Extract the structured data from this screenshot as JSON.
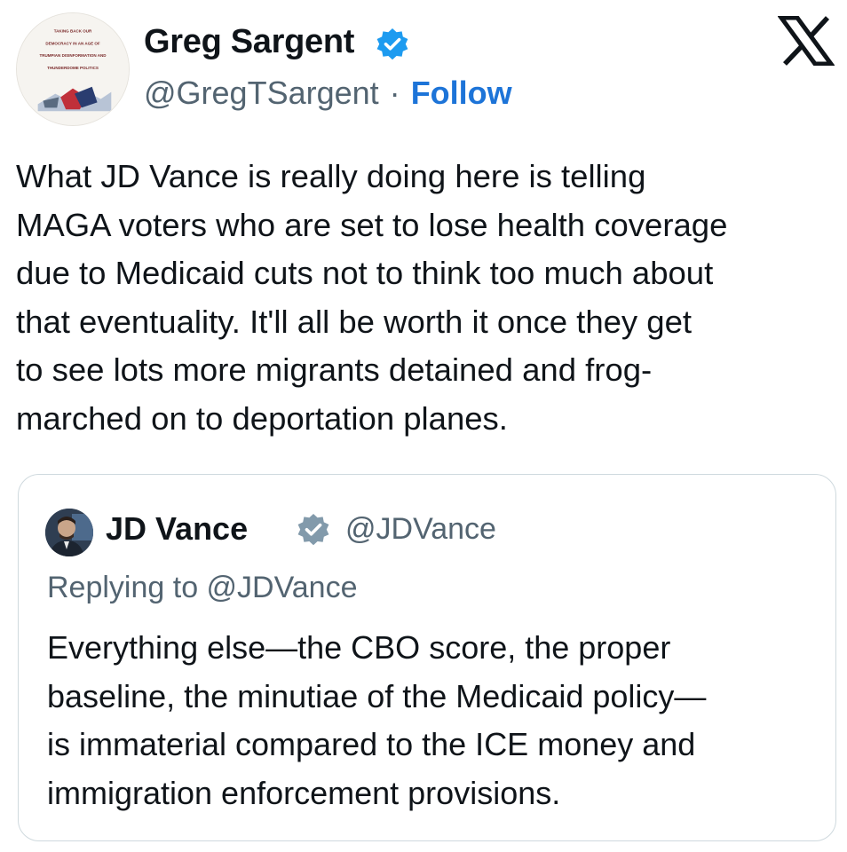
{
  "post": {
    "author": {
      "name": "Greg Sargent",
      "handle": "@GregTSargent",
      "separator": "·",
      "follow_label": "Follow",
      "verified_color": "#1d9bf0",
      "avatar_cover_lines": [
        "TAKING BACK OUR",
        "DEMOCRACY IN AN AGE OF",
        "TRUMPIAN DISINFORMATION AND",
        "THUNDERDOME POLITICS"
      ]
    },
    "platform_icon": "x-logo-icon",
    "text_lines": [
      "What JD Vance is really doing here is telling",
      "MAGA voters who are set to lose health coverage",
      "due to Medicaid cuts not to think too much about",
      "that eventuality. It'll all be worth it once they get",
      "to see lots more migrants detained and frog-",
      "marched on to deportation planes."
    ]
  },
  "quote": {
    "author": {
      "name": "JD Vance",
      "handle": "@JDVance",
      "verified_color": "#829aab"
    },
    "replying_to": "Replying to @JDVance",
    "text_lines": [
      "Everything else—the CBO score, the proper",
      "baseline, the minutiae of the Medicaid policy—",
      "is immaterial compared to the ICE money and",
      "immigration enforcement provisions."
    ]
  },
  "colors": {
    "link": "#1d74d8",
    "secondary_text": "#536471",
    "primary_text": "#0f1419",
    "card_border": "#cfd9de"
  }
}
